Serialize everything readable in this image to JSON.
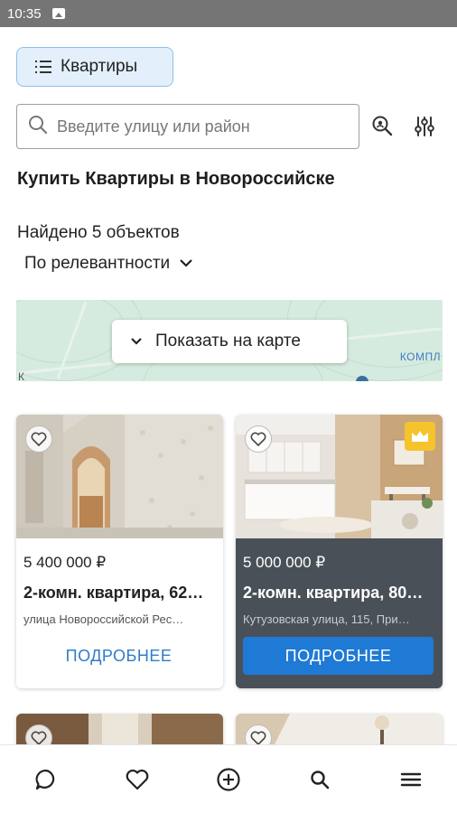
{
  "status_bar": {
    "time": "10:35",
    "notification_icon": "image-icon"
  },
  "filter": {
    "property_type": "Квартиры",
    "icon": "list-icon"
  },
  "search": {
    "placeholder": "Введите улицу или район",
    "icons": [
      "search-icon",
      "location-search-icon",
      "filter-sliders-icon"
    ]
  },
  "page": {
    "title": "Купить Квартиры в Новороссийске",
    "found_count": "Найдено 5 объектов",
    "sort_label": "По релевантности"
  },
  "map": {
    "button_label": "Показать на карте",
    "label_right": "КОМПЛ",
    "label_left": "К"
  },
  "listings": [
    {
      "price": "5 400 000 ₽",
      "title": "2-комн. квартира, 62…",
      "address": "улица Новороссийской Рес…",
      "button": "ПОДРОБНЕЕ",
      "premium": false
    },
    {
      "price": "5 000 000 ₽",
      "title": "2-комн. квартира, 80…",
      "address": "Кутузовская улица, 115, При…",
      "button": "ПОДРОБНЕЕ",
      "premium": true
    }
  ],
  "bottom_nav": [
    "chat-icon",
    "heart-icon",
    "add-circle-icon",
    "search-icon",
    "menu-icon"
  ],
  "colors": {
    "accent": "#1e7ad4",
    "link": "#2f7ccb",
    "chip_bg": "#e3f0fb",
    "premium": "#f5c32c",
    "dark_card": "#4a5058"
  }
}
